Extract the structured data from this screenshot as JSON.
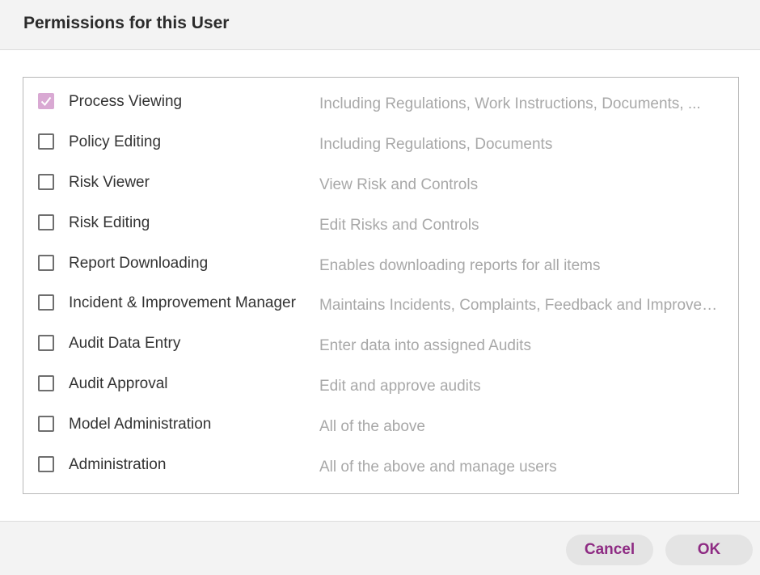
{
  "dialog": {
    "title": "Permissions for this User"
  },
  "permissions": [
    {
      "label": "Process Viewing",
      "description": "Including Regulations, Work Instructions, Documents, ...",
      "checked": true
    },
    {
      "label": "Policy Editing",
      "description": "Including Regulations, Documents",
      "checked": false
    },
    {
      "label": "Risk Viewer",
      "description": "View Risk and Controls",
      "checked": false
    },
    {
      "label": "Risk Editing",
      "description": "Edit Risks and Controls",
      "checked": false
    },
    {
      "label": "Report Downloading",
      "description": "Enables downloading reports for all items",
      "checked": false
    },
    {
      "label": "Incident & Improvement Manager",
      "description": "Maintains Incidents, Complaints, Feedback and Improvements",
      "checked": false
    },
    {
      "label": "Audit Data Entry",
      "description": "Enter data into assigned Audits",
      "checked": false
    },
    {
      "label": "Audit Approval",
      "description": "Edit and approve audits",
      "checked": false
    },
    {
      "label": "Model Administration",
      "description": "All of the above",
      "checked": false
    },
    {
      "label": "Administration",
      "description": "All of the above and manage users",
      "checked": false
    }
  ],
  "footer": {
    "cancel_label": "Cancel",
    "ok_label": "OK"
  },
  "colors": {
    "accent": "#8e2b83",
    "checked_fill": "#d9a9d3",
    "description_text": "#a8a8a8",
    "header_bg": "#f3f3f3",
    "button_bg": "#e4e4e4"
  }
}
